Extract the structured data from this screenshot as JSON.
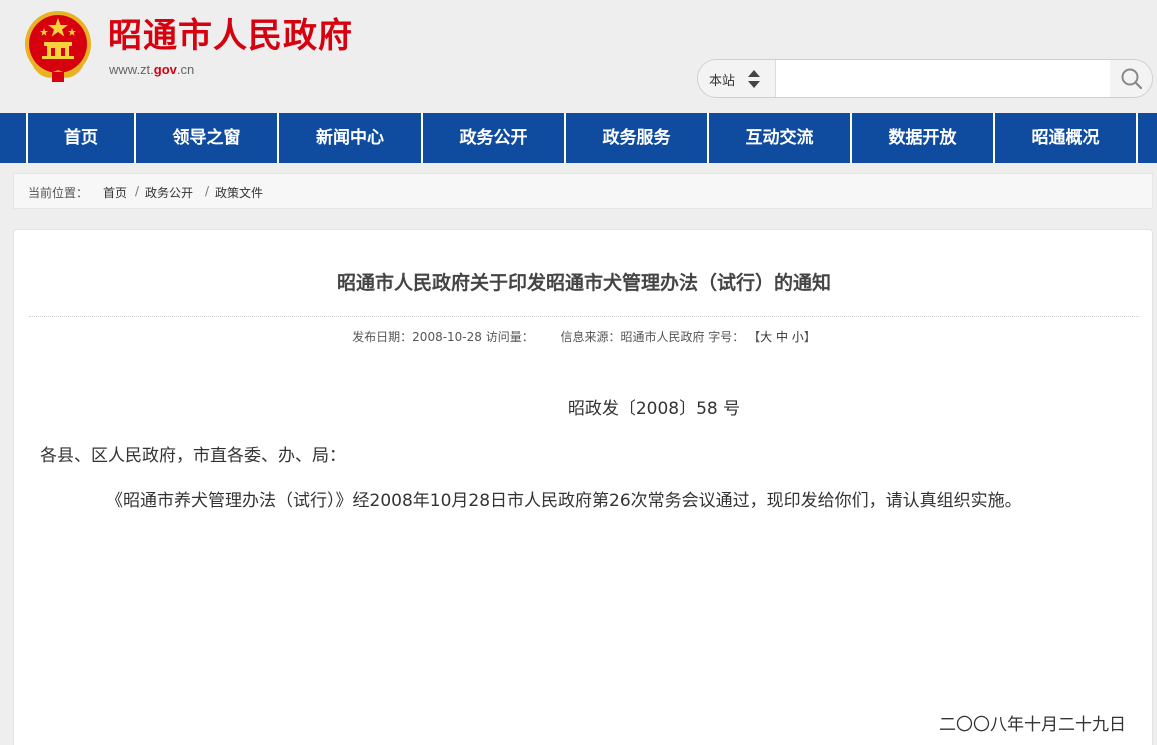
{
  "header": {
    "site_title": "昭通市人民政府",
    "url_prefix": "www.zt.",
    "url_highlight": "gov",
    "url_suffix": ".cn"
  },
  "search": {
    "scope_label": "本站",
    "placeholder": ""
  },
  "nav": {
    "items": [
      "首页",
      "领导之窗",
      "新闻中心",
      "政务公开",
      "政务服务",
      "互动交流",
      "数据开放",
      "昭通概况"
    ]
  },
  "breadcrumb": {
    "prefix": "当前位置：",
    "items": [
      "首页",
      "政务公开",
      "政策文件"
    ],
    "separator": "/"
  },
  "article": {
    "title": "昭通市人民政府关于印发昭通市犬管理办法（试行）的通知",
    "meta_date": "发布日期：2008-10-28 访问量：",
    "meta_source": "信息来源：昭通市人民政府 字号：",
    "size_open": "【",
    "size_large": "大",
    "size_medium": "中",
    "size_small": "小",
    "size_close": "】",
    "doc_number": "昭政发〔2008〕58 号",
    "addressee": "各县、区人民政府，市直各委、办、局：",
    "body": "《昭通市养犬管理办法（试行）》经2008年10月28日市人民政府第26次常务会议通过，现印发给你们，请认真组织实施。",
    "date": "二〇〇八年十月二十九日"
  },
  "colors": {
    "brand_red": "#d7000f",
    "nav_blue": "#0f4ca0"
  }
}
